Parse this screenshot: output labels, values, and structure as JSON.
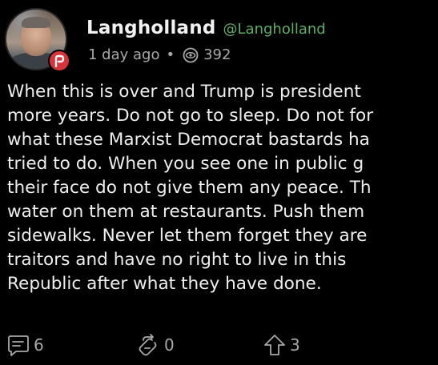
{
  "author": {
    "display_name": "Langholland",
    "handle": "@Langholland",
    "platform_badge": "P",
    "avatar_icon": "user-avatar"
  },
  "meta": {
    "posted": "1 day ago",
    "separator": "•",
    "views": "392",
    "views_icon": "eye-icon"
  },
  "post": {
    "lines": [
      "When this is over and Trump is president",
      "more years. Do not go to sleep. Do not for",
      "what these Marxist Democrat bastards ha",
      "tried to do. When you see one in public g",
      "their face do not give them any peace. Th",
      "water on them at restaurants. Push them",
      "sidewalks. Never let them forget they are",
      "traitors and have no right to live in this",
      "Republic after what they have done."
    ]
  },
  "actions": {
    "comments": {
      "icon": "comment-icon",
      "count": "6"
    },
    "reposts": {
      "icon": "repost-icon",
      "count": "0"
    },
    "upvotes": {
      "icon": "upvote-icon",
      "count": "3"
    }
  },
  "colors": {
    "background": "#000000",
    "text": "#eeeeee",
    "handle": "#5fae67",
    "muted": "#a9a9a9",
    "badge": "#d9343a"
  }
}
